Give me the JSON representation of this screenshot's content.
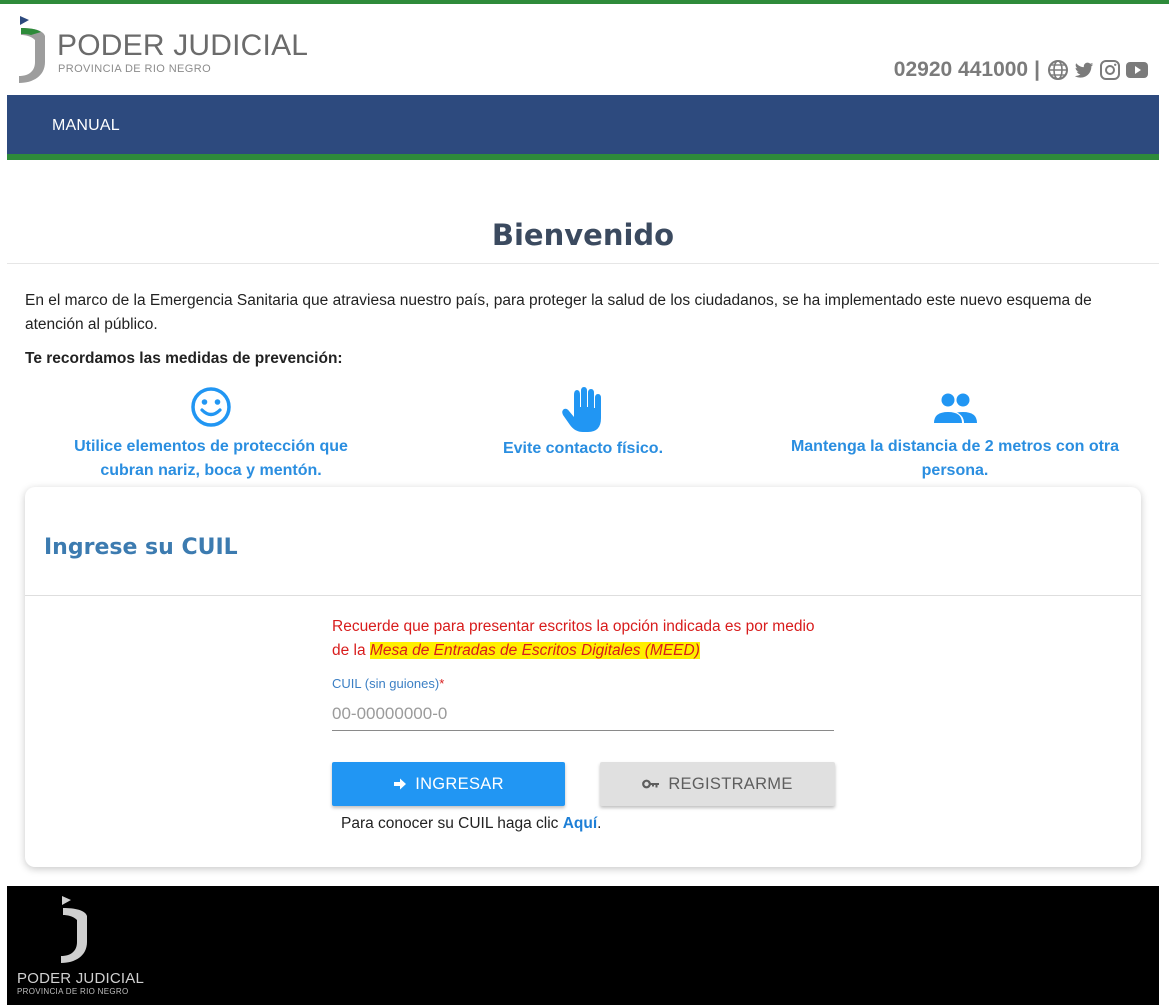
{
  "header": {
    "logo_title": "PODER JUDICIAL",
    "logo_subtitle": "PROVINCIA DE RIO NEGRO",
    "phone": "02920 441000",
    "separator": "|",
    "social_icons": [
      "globe-icon",
      "twitter-icon",
      "instagram-icon",
      "youtube-icon"
    ]
  },
  "nav": {
    "items": [
      {
        "label": "MANUAL"
      }
    ]
  },
  "welcome": {
    "title": "Bienvenido",
    "intro": "En el marco de la Emergencia Sanitaria que atraviesa nuestro país, para proteger la salud de los ciudadanos, se ha implementado este nuevo esquema de atención al público.",
    "prevention_title": "Te recordamos las medidas de prevención:"
  },
  "measures": [
    {
      "icon": "smiley-icon",
      "text": "Utilice elementos de protección que cubran nariz, boca y mentón."
    },
    {
      "icon": "hand-icon",
      "text": "Evite contacto físico."
    },
    {
      "icon": "people-icon",
      "text": "Mantenga la distancia de 2 metros con otra persona."
    }
  ],
  "login": {
    "title": "Ingrese su CUIL",
    "notice_text": "Recuerde que para presentar escritos la opción indicada es por medio de la ",
    "notice_highlight": "Mesa de Entradas de Escritos Digitales (MEED)",
    "field_label": "CUIL (sin guiones)",
    "field_required": "*",
    "field_placeholder": "00-00000000-0",
    "field_value": "",
    "login_button": "INGRESAR",
    "register_button": "REGISTRARME",
    "hint_text": "Para conocer su CUIL haga clic ",
    "hint_link": "Aquí",
    "hint_end": "."
  },
  "footer": {
    "logo_title": "PODER JUDICIAL",
    "logo_subtitle": "PROVINCIA DE RIO NEGRO"
  },
  "colors": {
    "green": "#2e8b3a",
    "navy": "#2d4a7e",
    "accent_blue": "#2196f3",
    "notice_red": "#d81c1c",
    "highlight": "#ffef00"
  }
}
